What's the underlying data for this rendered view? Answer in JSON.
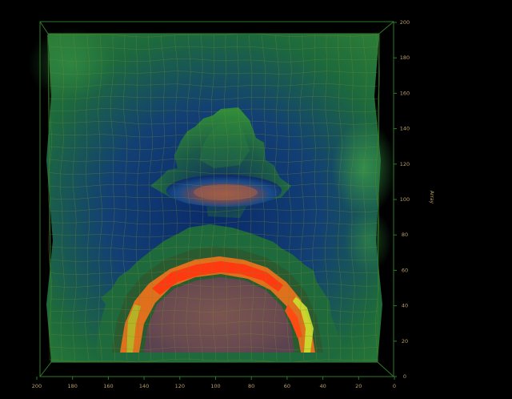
{
  "chart_data": {
    "type": "surface",
    "title": "",
    "xlabel": "",
    "ylabel": "Array",
    "x_ticks": [
      "200",
      "180",
      "160",
      "140",
      "120",
      "100",
      "80",
      "60",
      "40",
      "20",
      "0"
    ],
    "y_ticks": [
      "0",
      "20",
      "40",
      "60",
      "80",
      "100",
      "120",
      "140",
      "160",
      "180",
      "200"
    ],
    "xlim": [
      200,
      0
    ],
    "ylim": [
      0,
      200
    ],
    "grid": true,
    "colormap": [
      "#000010",
      "#102a6e",
      "#1f6e3a",
      "#2f8a3a",
      "#7a5a4a",
      "#d07020",
      "#ff3a10",
      "#c8e030"
    ],
    "features": [
      {
        "name": "upper-mound",
        "x_center": 98,
        "y_center": 102,
        "radius_x": 28,
        "radius_y": 7,
        "level": "peak"
      },
      {
        "name": "lower-arch",
        "x_center": 94,
        "y_center": 38,
        "radius_x": 48,
        "radius_y": 34,
        "level": "ridge"
      }
    ],
    "colors": {
      "background": "#000000",
      "frame": "#2f7a28",
      "mesh": "#7a8a30",
      "tick_text": "#b9a06a"
    }
  }
}
